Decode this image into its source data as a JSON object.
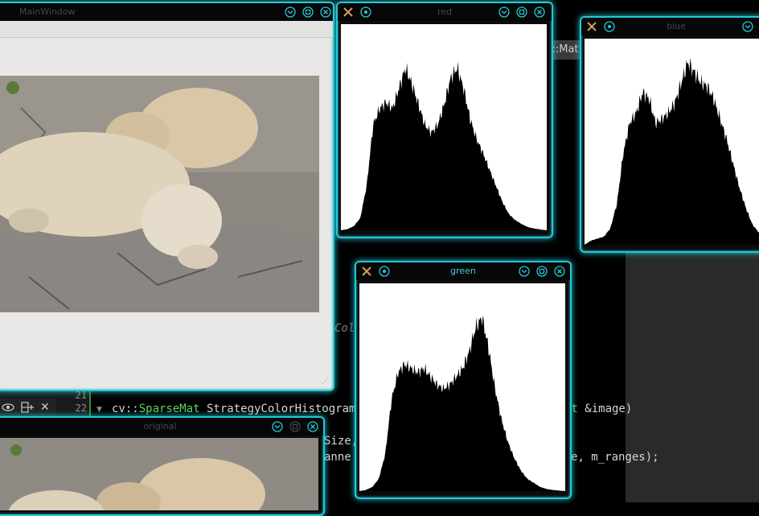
{
  "editor": {
    "tab_fragment": "::Mat",
    "line_numbers": [
      "21",
      "22"
    ],
    "frag_col": "Col",
    "line22_ns": "cv",
    "line22_sep": "::",
    "line22_type": "SparseMat",
    "line22_func": " StrategyColorHistogram",
    "line22_tail_kw": "at",
    "line22_tail": " &image)",
    "frag_size": "Size,",
    "frag_anne": "anne",
    "frag_ranges": "e, m_ranges);"
  },
  "windows": {
    "main": {
      "title": "MainWindow"
    },
    "red": {
      "title": "red"
    },
    "blue": {
      "title": "blue"
    },
    "green": {
      "title": "green"
    },
    "original": {
      "title": "original"
    }
  },
  "colors": {
    "accent": "#24c9d6",
    "histogram_fill": "#000000",
    "plot_bg": "#ffffff"
  },
  "chart_data": [
    {
      "type": "area",
      "title": "red",
      "x": [
        0,
        8,
        16,
        24,
        32,
        40,
        48,
        56,
        64,
        72,
        80,
        88,
        96,
        104,
        112,
        120,
        128,
        136,
        144,
        152,
        160,
        168,
        176,
        184,
        192,
        200,
        208,
        216,
        224,
        232,
        240,
        248,
        255
      ],
      "values": [
        0,
        0.5,
        2,
        6,
        22,
        52,
        60,
        63,
        60,
        70,
        80,
        72,
        62,
        52,
        48,
        52,
        62,
        75,
        80,
        70,
        55,
        45,
        38,
        30,
        22,
        14,
        8,
        5,
        3,
        1.5,
        0.8,
        0.3,
        0
      ],
      "ylim": [
        0,
        100
      ]
    },
    {
      "type": "area",
      "title": "blue",
      "x": [
        0,
        8,
        16,
        24,
        32,
        40,
        48,
        56,
        64,
        72,
        80,
        88,
        96,
        104,
        112,
        120,
        128,
        136,
        144,
        152,
        160,
        168,
        176,
        184,
        192,
        200,
        208,
        216,
        224,
        232,
        240,
        248,
        255
      ],
      "values": [
        0,
        2,
        3,
        4,
        8,
        20,
        45,
        60,
        65,
        75,
        72,
        60,
        62,
        65,
        70,
        80,
        90,
        85,
        80,
        78,
        72,
        62,
        52,
        40,
        28,
        18,
        10,
        6,
        3,
        1.5,
        0.8,
        0.3,
        0
      ],
      "ylim": [
        0,
        100
      ]
    },
    {
      "type": "area",
      "title": "green",
      "x": [
        0,
        8,
        16,
        24,
        32,
        40,
        48,
        56,
        64,
        72,
        80,
        88,
        96,
        104,
        112,
        120,
        128,
        136,
        144,
        152,
        160,
        168,
        176,
        184,
        192,
        200,
        208,
        216,
        224,
        232,
        240,
        248,
        255
      ],
      "values": [
        0,
        0.5,
        2,
        6,
        18,
        45,
        58,
        62,
        60,
        58,
        60,
        56,
        52,
        50,
        52,
        56,
        60,
        68,
        80,
        85,
        70,
        50,
        35,
        24,
        16,
        10,
        6,
        4,
        2,
        1,
        0.5,
        0.2,
        0
      ],
      "ylim": [
        0,
        100
      ]
    }
  ]
}
